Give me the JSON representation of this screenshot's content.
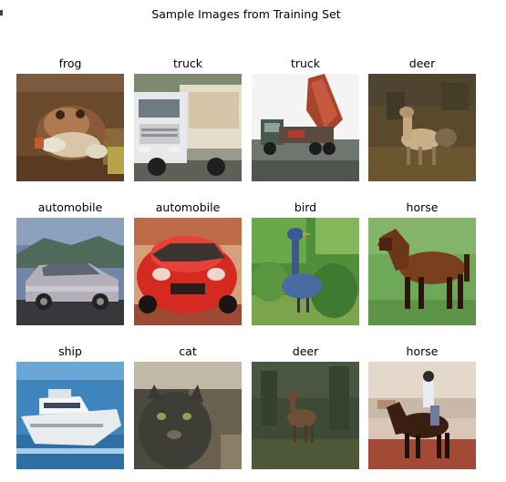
{
  "figure": {
    "title": "Sample Images from Training Set"
  },
  "images": [
    {
      "label": "frog"
    },
    {
      "label": "truck"
    },
    {
      "label": "truck"
    },
    {
      "label": "deer"
    },
    {
      "label": "automobile"
    },
    {
      "label": "automobile"
    },
    {
      "label": "bird"
    },
    {
      "label": "horse"
    },
    {
      "label": "ship"
    },
    {
      "label": "cat"
    },
    {
      "label": "deer"
    },
    {
      "label": "horse"
    }
  ]
}
